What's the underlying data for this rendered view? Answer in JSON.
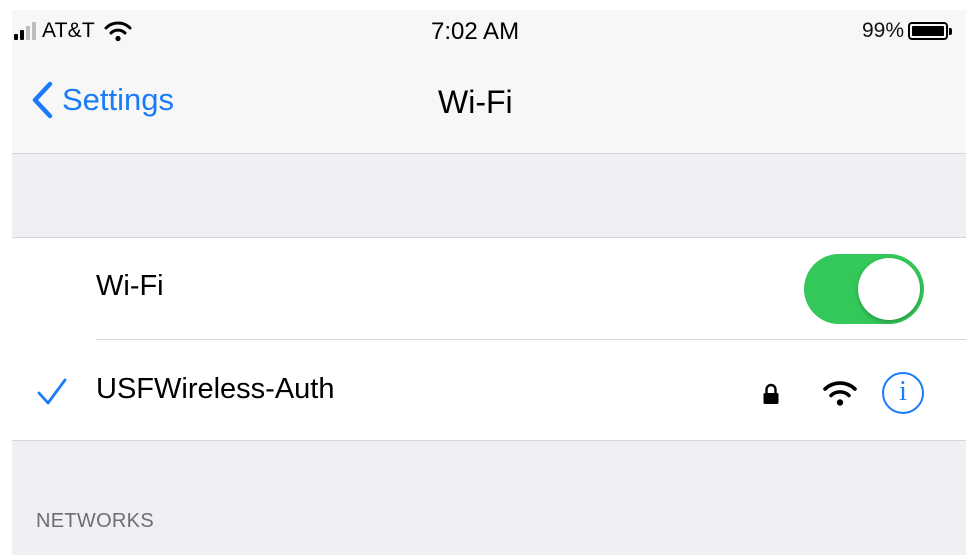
{
  "status_bar": {
    "carrier": "AT&T",
    "time": "7:02 AM",
    "battery_percent": "99%",
    "battery_level": 0.99,
    "signal_bars_filled": 2,
    "signal_bars_total": 4
  },
  "nav": {
    "back_label": "Settings",
    "title": "Wi-Fi"
  },
  "wifi_toggle": {
    "label": "Wi-Fi",
    "on": true,
    "on_color": "#34c759"
  },
  "connected_network": {
    "name": "USFWireless-Auth",
    "secured": true,
    "icons": [
      "checkmark-icon",
      "lock-icon",
      "wifi-icon",
      "info-icon"
    ],
    "info_glyph": "i"
  },
  "networks_section": {
    "header": "NETWORKS"
  },
  "colors": {
    "accent": "#1a7cf8",
    "background": "#efeff4",
    "bar_background": "#f7f7f7",
    "separator": "#d6d6da"
  }
}
